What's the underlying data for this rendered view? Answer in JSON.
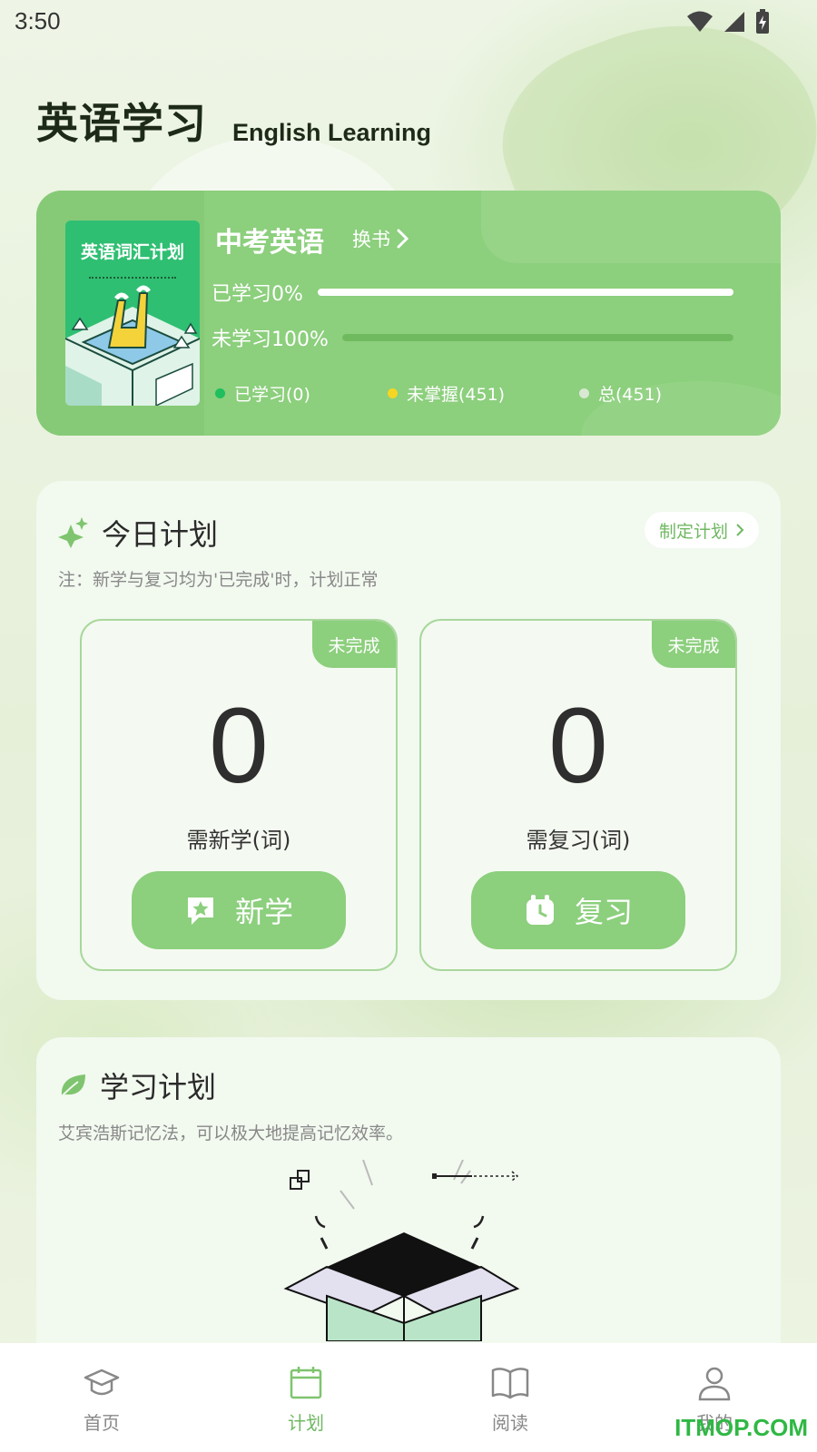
{
  "status": {
    "time": "3:50"
  },
  "header": {
    "title_cn": "英语学习",
    "title_en": "English Learning"
  },
  "book": {
    "cover_title": "英语词汇计划",
    "name": "中考英语",
    "switch_label": "换书",
    "learned_label": "已学习0%",
    "unlearned_label": "未学习100%",
    "learned_fraction": 0.0,
    "unlearned_fraction": 1.0,
    "legend": [
      {
        "label": "已学习(0)",
        "color": "#1fbf5e"
      },
      {
        "label": "未掌握(451)",
        "color": "#f5d623"
      },
      {
        "label": "总(451)",
        "color": "#d8e8d2"
      }
    ]
  },
  "today_plan": {
    "title": "今日计划",
    "note": "注：新学与复习均为'已完成'时，计划正常",
    "make_plan_label": "制定计划",
    "tasks": [
      {
        "status": "未完成",
        "count": "0",
        "label": "需新学(词)",
        "button": "新学"
      },
      {
        "status": "未完成",
        "count": "0",
        "label": "需复习(词)",
        "button": "复习"
      }
    ]
  },
  "study_plan": {
    "title": "学习计划",
    "description": "艾宾浩斯记忆法，可以极大地提高记忆效率。"
  },
  "tabs": [
    {
      "label": "首页",
      "icon": "graduation-cap-icon"
    },
    {
      "label": "计划",
      "icon": "calendar-icon",
      "active": true
    },
    {
      "label": "阅读",
      "icon": "book-open-icon"
    },
    {
      "label": "我的",
      "icon": "user-icon"
    }
  ],
  "watermark": "ITMOP.COM",
  "colors": {
    "accent": "#8ccf7d",
    "accent_text": "#6fb862"
  }
}
